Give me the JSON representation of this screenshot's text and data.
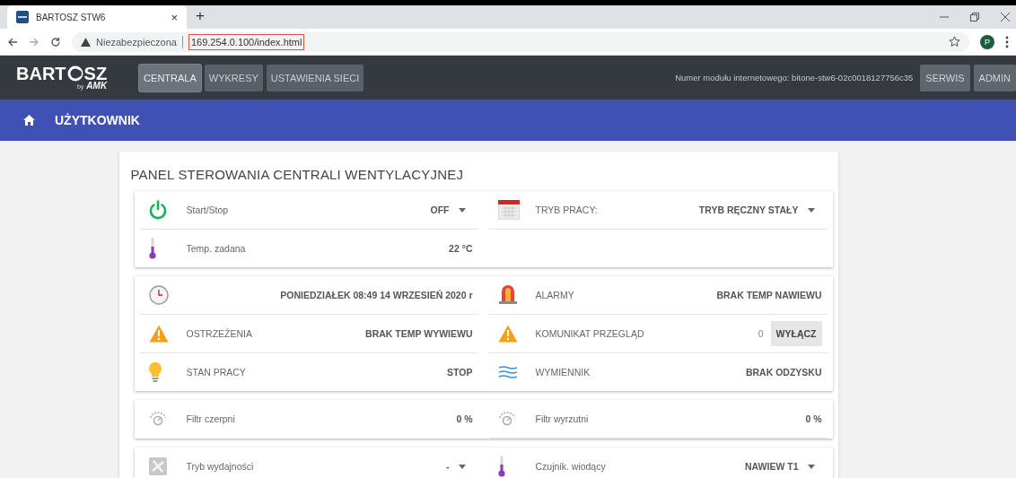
{
  "browser": {
    "tab": {
      "title": "BARTOSZ STW6",
      "close": "×",
      "selected": true
    },
    "new_tab": "+",
    "security": "Niezabezpieczona",
    "url": "169.254.0.100/index.html",
    "avatar": "P"
  },
  "navbar": {
    "logo": {
      "text_before": "BART",
      "text_after": "SZ",
      "tagline": "by",
      "brand": "AMK"
    },
    "tabs": [
      {
        "label": "CENTRALA",
        "selected": true
      },
      {
        "label": "WYKRESY",
        "selected": false
      },
      {
        "label": "USTAWIENIA SIECI",
        "selected": false
      }
    ],
    "module_info": "Numer modułu internetowego: bitone-stw6-02c0018127756c35",
    "buttons": [
      "SERWIS",
      "ADMIN"
    ]
  },
  "breadcrumb": {
    "title": "UŻYTKOWNIK"
  },
  "panel": {
    "title": "PANEL STEROWANIA CENTRALI WENTYLACYJNEJ",
    "sections": [
      {
        "columns": [
          [
            {
              "kind": "dropdown",
              "label": "Start/Stop",
              "value": "OFF"
            },
            {
              "kind": "reading",
              "label": "Temp. zadana",
              "value": "22 °C"
            }
          ],
          [
            {
              "kind": "dropdown",
              "label": "TRYB PRACY:",
              "value": "TRYB RĘCZNY STAŁY"
            }
          ]
        ]
      },
      {
        "columns": [
          [
            {
              "kind": "reading",
              "value": "PONIEDZIAŁEK 08:49 14 WRZESIEŃ 2020 r"
            },
            {
              "kind": "reading",
              "label": "OSTRZEŻENIA",
              "value": "BRAK TEMP WYWIEWU"
            },
            {
              "kind": "reading",
              "label": "STAN PRACY",
              "value": "STOP"
            }
          ],
          [
            {
              "kind": "reading",
              "label": "ALARMY",
              "value": "BRAK TEMP NAWIEWU"
            },
            {
              "kind": "counter",
              "label": "KOMUNIKAT PRZEGLĄD",
              "value": "0",
              "button": "WYŁĄCZ"
            },
            {
              "kind": "reading",
              "label": "WYMIENNIK",
              "value": "BRAK ODZYSKU"
            }
          ]
        ]
      },
      {
        "columns": [
          [
            {
              "kind": "reading",
              "label": "Filtr czerpni",
              "value": "0 %"
            }
          ],
          [
            {
              "kind": "reading",
              "label": "Filtr wyrzutni",
              "value": "0 %"
            }
          ]
        ]
      },
      {
        "columns": [
          [
            {
              "kind": "dropdown",
              "label": "Tryb wydajności",
              "value": "-"
            }
          ],
          [
            {
              "kind": "dropdown",
              "label": "Czujnik. wiodący",
              "value": "NAWIEW T1"
            }
          ]
        ]
      }
    ]
  }
}
